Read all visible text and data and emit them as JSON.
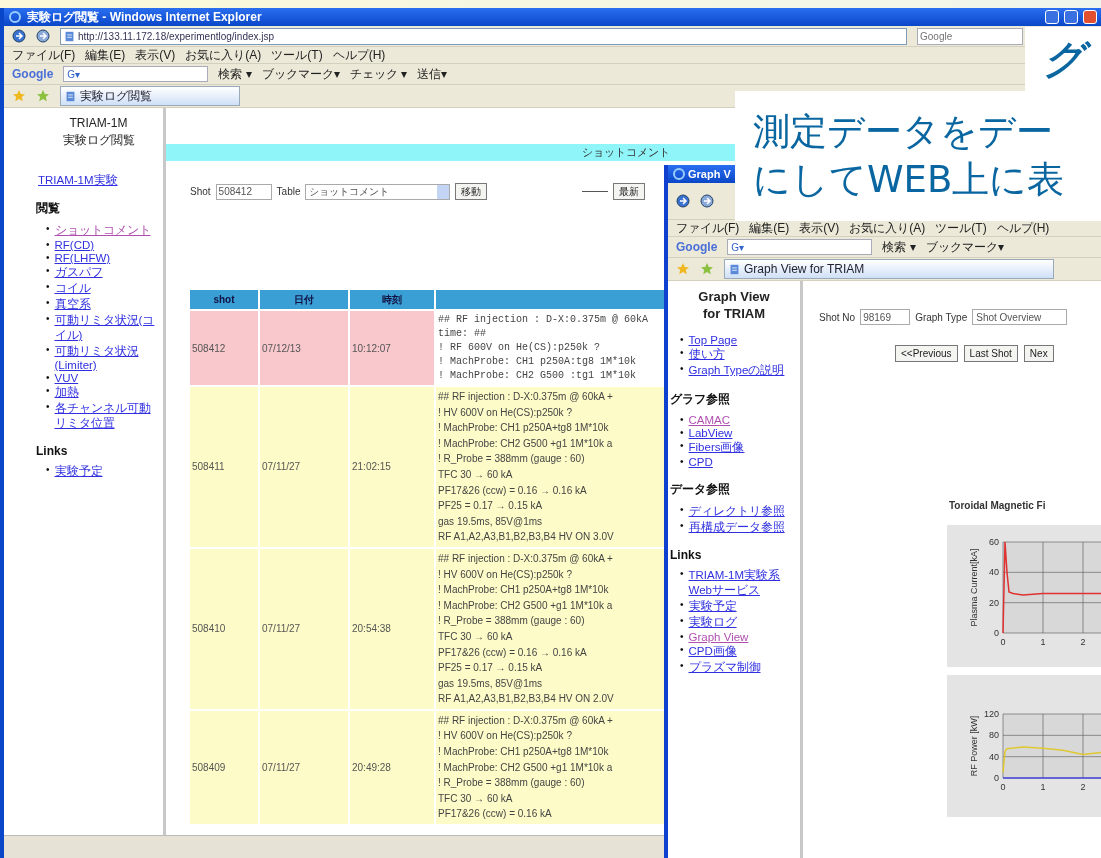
{
  "callouts": {
    "headline": "グ",
    "caption_lines": [
      "測定データをデー",
      "にしてWEB上に表"
    ]
  },
  "log_window": {
    "title": "実験ログ閲覧 - Windows Internet Explorer",
    "address": "http://133.11.172.18/experimentlog/index.jsp",
    "search_placeholder": "Google",
    "menu": [
      "ファイル(F)",
      "編集(E)",
      "表示(V)",
      "お気に入り(A)",
      "ツール(T)",
      "ヘルプ(H)"
    ],
    "google_bar": {
      "logo": "Google",
      "field": "G▾",
      "items": [
        "検索 ▾",
        "ブックマーク▾",
        "チェック ▾",
        "送信▾"
      ]
    },
    "tab": "実験ログ閲覧",
    "sidebar": {
      "title_lines": [
        "TRIAM-1M",
        "実験ログ閲覧"
      ],
      "top_link": "TRIAM-1M実験",
      "sections": [
        {
          "heading": "閲覧",
          "links": [
            {
              "bullet": "•",
              "label": "ショットコメント",
              "visited": true
            },
            {
              "bullet": "•",
              "label": "RF(CD)",
              "visited": false
            },
            {
              "bullet": "•",
              "label": "RF(LHFW)",
              "visited": false
            },
            {
              "bullet": "•",
              "label": "ガスパフ",
              "visited": false
            },
            {
              "bullet": "•",
              "label": "コイル",
              "visited": false
            },
            {
              "bullet": "•",
              "label": "真空系",
              "visited": false
            },
            {
              "bullet": "•",
              "label": "可動リミタ状況(コイル)",
              "visited": false
            },
            {
              "bullet": "•",
              "label": "可動リミタ状況(Limiter)",
              "visited": false
            },
            {
              "bullet": "•",
              "label": "VUV",
              "visited": false
            },
            {
              "bullet": "•",
              "label": "加熱",
              "visited": false
            },
            {
              "bullet": "•",
              "label": "各チャンネル可動リミタ位置",
              "visited": false
            }
          ]
        },
        {
          "heading": "Links",
          "links": [
            {
              "bullet": "•",
              "label": "実験予定",
              "visited": false
            }
          ]
        }
      ]
    },
    "page_heading": "ショットコメント",
    "form": {
      "shot_label": "Shot",
      "shot_value": "508412",
      "table_label": "Table",
      "table_value": "ショットコメント",
      "go_button": "移動",
      "latest_button": "最新"
    },
    "table": {
      "columns": [
        "shot",
        "日付",
        "時刻",
        ""
      ],
      "rows": [
        {
          "selected": true,
          "shot": "508412",
          "date": "07/12/13",
          "time": "10:12:07",
          "comment": [
            "## RF injection : D-X:0.375m @ 60kA",
            "time: ##",
            "! RF 600V on He(CS):p250k ?",
            "! MachProbe: CH1 p250A:tg8 1M*10k",
            "! MachProbe: CH2 G500 :tg1 1M*10k"
          ]
        },
        {
          "selected": false,
          "shot": "508411",
          "date": "07/11/27",
          "time": "21:02:15",
          "comment": [
            "## RF injection : D-X:0.375m @ 60kA +",
            "! HV 600V on He(CS):p250k ?",
            "! MachProbe: CH1 p250A+tg8 1M*10k",
            "! MachProbe: CH2 G500 +g1 1M*10k a",
            "! R_Probe = 388mm (gauge : 60)",
            "TFC 30 → 60 kA",
            "PF17&26 (ccw) = 0.16 → 0.16 kA",
            "PF25 = 0.17 → 0.15 kA",
            "gas 19.5ms, 85V@1ms",
            "RF A1,A2,A3,B1,B2,B3,B4 HV ON 3.0V"
          ]
        },
        {
          "selected": false,
          "shot": "508410",
          "date": "07/11/27",
          "time": "20:54:38",
          "comment": [
            "## RF injection : D-X:0.375m @ 60kA +",
            "! HV 600V on He(CS):p250k ?",
            "! MachProbe: CH1 p250A+tg8 1M*10k",
            "! MachProbe: CH2 G500 +g1 1M*10k a",
            "! R_Probe = 388mm (gauge : 60)",
            "TFC 30 → 60 kA",
            "PF17&26 (ccw) = 0.16 → 0.16 kA",
            "PF25 = 0.17 → 0.15 kA",
            "gas 19.5ms, 85V@1ms",
            "RF A1,A2,A3,B1,B2,B3,B4 HV ON 2.0V"
          ]
        },
        {
          "selected": false,
          "shot": "508409",
          "date": "07/11/27",
          "time": "20:49:28",
          "comment": [
            "## RF injection : D-X:0.375m @ 60kA +",
            "! HV 600V on He(CS):p250k ?",
            "! MachProbe: CH1 p250A+tg8 1M*10k",
            "! MachProbe: CH2 G500 +g1 1M*10k a",
            "! R_Probe = 388mm (gauge : 60)",
            "TFC 30 → 60 kA",
            "PF17&26 (ccw) = 0.16 kA"
          ]
        }
      ]
    }
  },
  "graph_window": {
    "title": "Graph V",
    "menu": [
      "ファイル(F)",
      "編集(E)",
      "表示(V)",
      "お気に入り(A)",
      "ツール(T)",
      "ヘルプ(H)"
    ],
    "google_bar": {
      "logo": "Google",
      "field": "G▾",
      "items": [
        "検索 ▾",
        "ブックマーク▾"
      ]
    },
    "tab": "Graph View for TRIAM",
    "sidebar": {
      "title_lines": [
        "Graph View",
        "for TRIAM"
      ],
      "top_links": [
        {
          "bullet": "•",
          "label": "Top Page",
          "visited": false
        },
        {
          "bullet": "•",
          "label": "使い方",
          "visited": false
        },
        {
          "bullet": "•",
          "label": "Graph Typeの説明",
          "visited": false
        }
      ],
      "sections": [
        {
          "heading": "グラフ参照",
          "links": [
            {
              "bullet": "•",
              "label": "CAMAC",
              "visited": true
            },
            {
              "bullet": "•",
              "label": "LabView",
              "visited": false
            },
            {
              "bullet": "•",
              "label": "Fibers画像",
              "visited": false
            },
            {
              "bullet": "•",
              "label": "CPD",
              "visited": false
            }
          ]
        },
        {
          "heading": "データ参照",
          "links": [
            {
              "bullet": "•",
              "label": "ディレクトリ参照",
              "visited": false
            },
            {
              "bullet": "•",
              "label": "再構成データ参照",
              "visited": false
            }
          ]
        },
        {
          "heading": "Links",
          "links": [
            {
              "bullet": "•",
              "label": "TRIAM-1M実験系 Webサービス",
              "visited": false
            },
            {
              "bullet": "•",
              "label": "実験予定",
              "visited": false
            },
            {
              "bullet": "•",
              "label": "実験ログ",
              "visited": false
            },
            {
              "bullet": "•",
              "label": "Graph View",
              "visited": true
            },
            {
              "bullet": "•",
              "label": "CPD画像",
              "visited": false
            },
            {
              "bullet": "•",
              "label": "プラズマ制御",
              "visited": false
            }
          ]
        }
      ]
    },
    "form": {
      "shot_label": "Shot No",
      "shot_value": "98169",
      "type_label": "Graph Type",
      "type_value": "Shot Overview"
    },
    "nav_buttons": [
      "<<Previous",
      "Last Shot",
      "Nex"
    ],
    "chart_title": "Toroidal Magnetic Fi",
    "charts": [
      {
        "chart_data": {
          "type": "line",
          "ylabel": "Plasma Current[kA]",
          "x": [
            0,
            0.05,
            0.1,
            0.15,
            0.25,
            0.5,
            1,
            1.5,
            2,
            2.5
          ],
          "series": [
            {
              "color": "#e03030",
              "values": [
                0,
                60,
                40,
                27,
                26,
                25,
                26,
                26,
                26,
                26
              ]
            }
          ],
          "xlim": [
            0,
            2.5
          ],
          "ylim": [
            0,
            60
          ],
          "xticks": [
            0,
            1,
            2
          ],
          "yticks": [
            0,
            20,
            40,
            60
          ],
          "grid": true
        }
      },
      {
        "chart_data": {
          "type": "line",
          "ylabel": "RF Power [kW]",
          "x": [
            0,
            0.05,
            0.1,
            0.5,
            1,
            1.5,
            2,
            2.5
          ],
          "series": [
            {
              "color": "#e0c830",
              "values": [
                10,
                50,
                55,
                58,
                56,
                52,
                44,
                48
              ]
            },
            {
              "color": "#4848e0",
              "values": [
                0,
                0,
                0,
                0,
                0,
                0,
                0,
                0
              ]
            }
          ],
          "xlim": [
            0,
            2.5
          ],
          "ylim": [
            0,
            120
          ],
          "xticks": [
            0,
            1,
            2
          ],
          "yticks": [
            0,
            40,
            80,
            120
          ],
          "grid": true
        }
      }
    ]
  }
}
